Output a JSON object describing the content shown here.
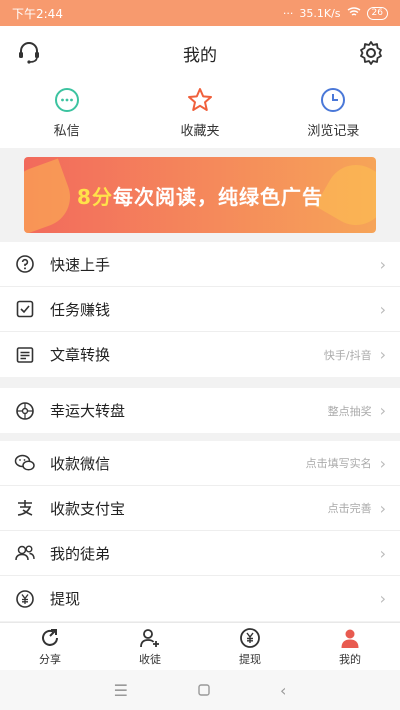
{
  "status": {
    "time": "下午2:44",
    "network": "35.1K/s",
    "battery": "26"
  },
  "header": {
    "title": "我的"
  },
  "quick": [
    {
      "label": "私信"
    },
    {
      "label": "收藏夹"
    },
    {
      "label": "浏览记录"
    }
  ],
  "banner": {
    "highlight": "8分",
    "text": "每次阅读，纯绿色广告"
  },
  "section1": [
    {
      "label": "快速上手",
      "hint": ""
    },
    {
      "label": "任务赚钱",
      "hint": ""
    },
    {
      "label": "文章转换",
      "hint": "快手/抖音"
    }
  ],
  "section2": [
    {
      "label": "幸运大转盘",
      "hint": "整点抽奖"
    }
  ],
  "section3": [
    {
      "label": "收款微信",
      "hint": "点击填写实名"
    },
    {
      "label": "收款支付宝",
      "hint": "点击完善"
    },
    {
      "label": "我的徒弟",
      "hint": ""
    },
    {
      "label": "提现",
      "hint": ""
    }
  ],
  "tabs": [
    {
      "label": "分享"
    },
    {
      "label": "收徒"
    },
    {
      "label": "提现"
    },
    {
      "label": "我的"
    }
  ],
  "colors": {
    "accent": "#f79a6e",
    "active_tab": "#e85a4f"
  }
}
